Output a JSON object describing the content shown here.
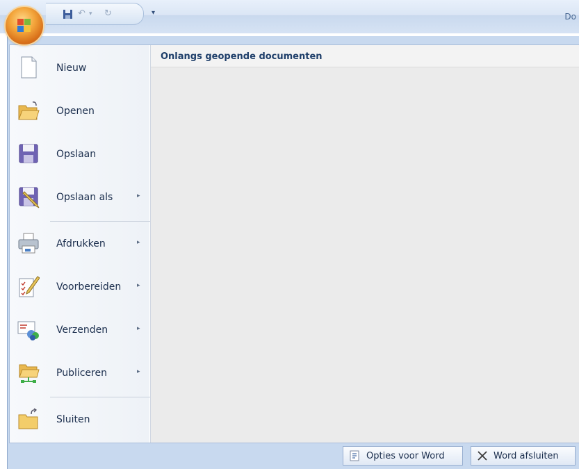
{
  "titlebar": {
    "title": "Do",
    "qat_dropdown": "▾"
  },
  "menu": {
    "items": [
      {
        "label": "Nieuw",
        "icon": "new-document-icon",
        "submenu": false
      },
      {
        "label": "Openen",
        "icon": "open-folder-icon",
        "submenu": false
      },
      {
        "label": "Opslaan",
        "icon": "save-icon",
        "submenu": false
      },
      {
        "label": "Opslaan als",
        "icon": "save-as-icon",
        "submenu": true
      },
      {
        "label": "Afdrukken",
        "icon": "print-icon",
        "submenu": true
      },
      {
        "label": "Voorbereiden",
        "icon": "prepare-icon",
        "submenu": true
      },
      {
        "label": "Verzenden",
        "icon": "send-icon",
        "submenu": true
      },
      {
        "label": "Publiceren",
        "icon": "publish-icon",
        "submenu": true
      },
      {
        "label": "Sluiten",
        "icon": "close-folder-icon",
        "submenu": false
      }
    ],
    "submenu_arrow": "▸",
    "recent": {
      "title": "Onlangs geopende documenten"
    }
  },
  "bottom": {
    "options_label": "Opties voor Word",
    "exit_label": "Word afsluiten"
  },
  "colors": {
    "accent": "#1f3f6a",
    "office_button": "#e8862a",
    "frame": "#c8d9ef"
  }
}
